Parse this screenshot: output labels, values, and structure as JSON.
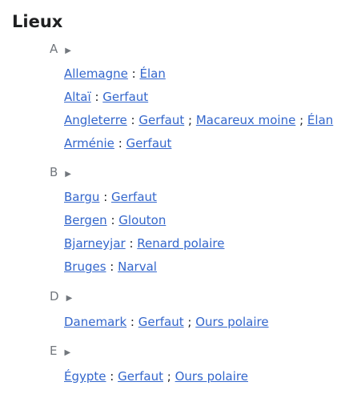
{
  "page": {
    "title": "Lieux"
  },
  "groups": [
    {
      "letter": "A",
      "toggle": "▶",
      "entries": [
        {
          "place": "Allemagne",
          "animals": [
            "Élan"
          ]
        },
        {
          "place": "Altaï",
          "animals": [
            "Gerfaut"
          ]
        },
        {
          "place": "Angleterre",
          "animals": [
            "Gerfaut",
            "Macareux moine",
            "Élan"
          ]
        },
        {
          "place": "Arménie",
          "animals": [
            "Gerfaut"
          ]
        }
      ]
    },
    {
      "letter": "B",
      "toggle": "▶",
      "entries": [
        {
          "place": "Bargu",
          "animals": [
            "Gerfaut"
          ]
        },
        {
          "place": "Bergen",
          "animals": [
            "Glouton"
          ]
        },
        {
          "place": "Bjarneyjar",
          "animals": [
            "Renard polaire"
          ]
        },
        {
          "place": "Bruges",
          "animals": [
            "Narval"
          ]
        }
      ]
    },
    {
      "letter": "D",
      "toggle": "▶",
      "entries": [
        {
          "place": "Danemark",
          "animals": [
            "Gerfaut",
            "Ours polaire"
          ]
        }
      ]
    },
    {
      "letter": "E",
      "toggle": "▶",
      "entries": [
        {
          "place": "Égypte",
          "animals": [
            "Gerfaut",
            "Ours polaire"
          ]
        }
      ]
    }
  ],
  "separators": {
    "place_sep": " : ",
    "animal_sep": " ; "
  }
}
